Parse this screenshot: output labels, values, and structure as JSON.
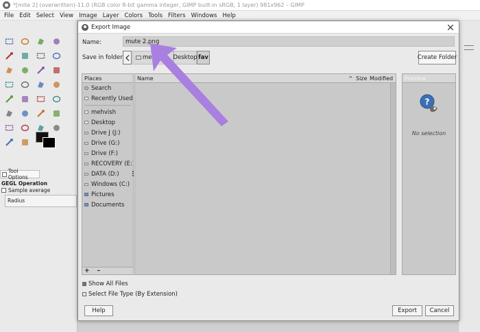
{
  "window": {
    "title": "*[mite 2] (overwritten)-11.0 (RGB color 8-bit gamma integer, GIMP built-in sRGB, 1 layer) 981x962 – GIMP"
  },
  "menubar": {
    "items": [
      "File",
      "Edit",
      "Select",
      "View",
      "Image",
      "Layer",
      "Colors",
      "Tools",
      "Filters",
      "Windows",
      "Help"
    ]
  },
  "toolbox": {
    "tools": [
      "rect-select-icon",
      "ellipse-select-icon",
      "free-select-icon",
      "fuzzy-select-icon",
      "by-color-select-icon",
      "scissors-icon",
      "color-picker-icon",
      "zoom-icon",
      "measure-icon",
      "move-icon",
      "align-icon",
      "crop-icon",
      "unified-transform-icon",
      "rotate-icon",
      "scale-icon",
      "shear-icon",
      "warp-transform-icon",
      "gradient-icon",
      "paintbrush-icon",
      "pencil-icon",
      "airbrush-icon",
      "ink-icon",
      "mypaint-brush-icon",
      "clone-icon",
      "heal-icon",
      "perspective-clone-icon",
      "smudge-icon",
      "dodge-burn-icon",
      "path-icon",
      "text-icon"
    ],
    "options_tab": "Tool Options",
    "gegl_title": "GEGL Operation",
    "sample_average": "Sample average",
    "radius_label": "Radius"
  },
  "dialog": {
    "title": "Export Image",
    "name_label": "Name:",
    "name_value": "mute 2.png",
    "save_in_label": "Save in folder:",
    "path": [
      "mehvish",
      "Desktop",
      "fav"
    ],
    "create_folder": "Create Folder",
    "places": {
      "header": "Places",
      "top_items": [
        "Search",
        "Recently Used"
      ],
      "items": [
        "mehvish",
        "Desktop",
        "Drive J (J:)",
        "Drive (G:)",
        "Drive (F:)",
        "RECOVERY (E:)",
        "DATA (D:)",
        "Windows (C:)",
        "Pictures",
        "Documents"
      ],
      "footer": "+ –"
    },
    "files": {
      "col_name": "Name",
      "col_size": "Size",
      "col_modified": "Modified"
    },
    "preview": {
      "header": "Preview",
      "text": "No selection"
    },
    "show_all_files": "Show All Files",
    "select_file_type": "Select File Type (By Extension)",
    "help": "Help",
    "export": "Export",
    "cancel": "Cancel"
  },
  "colors": {
    "annotation_arrow": "#a97fe0",
    "foreground": "#111111",
    "background": "#000000"
  }
}
